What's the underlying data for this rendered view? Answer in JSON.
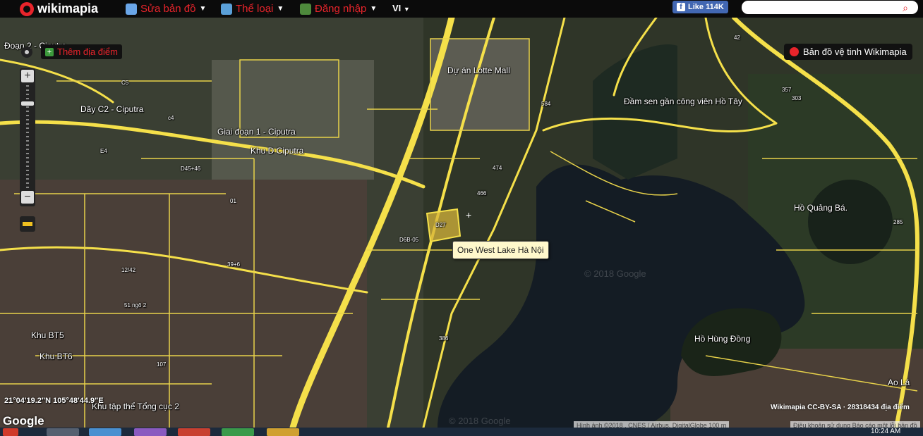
{
  "topbar": {
    "logo_text": "wikimapia",
    "menu": [
      {
        "label": "Sửa bản đồ",
        "icon": "map-edit-icon"
      },
      {
        "label": "Thể loại",
        "icon": "category-icon"
      },
      {
        "label": "Đăng nhập",
        "icon": "login-icon"
      }
    ],
    "lang": "VI",
    "fb_like": "Like 114K",
    "search_placeholder": ""
  },
  "controls": {
    "add_place": "Thêm địa điểm",
    "satellite": "Bản đồ vệ tinh Wikimapia",
    "zoom_in": "+",
    "zoom_out": "−"
  },
  "labels": {
    "doan2": "Đoạn 2 - Ciputra",
    "c5": "C5",
    "day_c2": "Dãy C2 - Ciputra",
    "c4": "c4",
    "giai_doan1": "Giai đoạn 1 - Ciputra",
    "khu_d": "Khu D Ciputra",
    "e4": "E4",
    "d45": "D45+46",
    "o1": "01",
    "lotte": "Dự án Lotte Mall",
    "dam_sen": "Đầm sen gần công viên Hồ Tây",
    "n584": "584",
    "n474": "474",
    "n466": "466",
    "d27": "D27",
    "d6b": "D6B-05",
    "ho_quang_ba": "Hồ Quảng Bá.",
    "n12_42": "12/42",
    "n39": "39+6",
    "n51": "51 ngõ 2",
    "khu_bt5": "Khu BT5",
    "khu_bt6": "Khu BT6",
    "n107": "107",
    "n386": "386",
    "ho_hung_dong": "Hồ Hùng Đồng",
    "ao_la": "Ao Lá",
    "khu_tap_the": "Khu tập thể Tổng cục 2",
    "n42": "42",
    "n357": "357",
    "n303": "303",
    "n285": "285"
  },
  "watermarks": [
    "© 2018 Google",
    "© 2018 Google"
  ],
  "tooltip": "One West Lake Hà Nội",
  "coordinates": "21°04'19.2\"N 105°48'44.9\"E",
  "google_logo": "Google",
  "attribution": "Hình ảnh ©2018 , CNES / Airbus, DigitalGlobe   100 m",
  "terms": "Điều khoản sử dụng   Báo cáo một lỗi bản đồ",
  "license": "Wikimapia CC-BY-SA · 28318434 địa điểm",
  "clock": "10:24 AM",
  "colors": {
    "road": "#f5e04a",
    "accent": "#e8242b",
    "lake": "#141c24"
  }
}
